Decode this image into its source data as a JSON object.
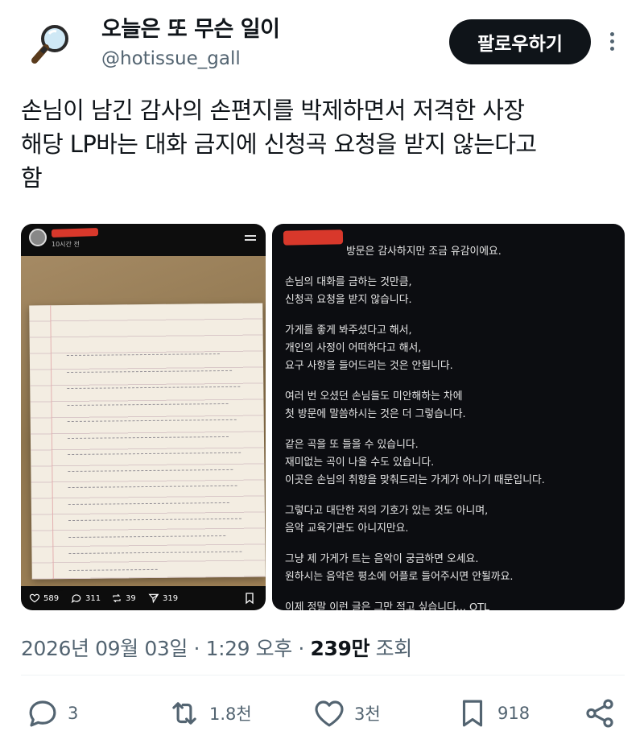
{
  "profile": {
    "display_name": "오늘은 또 무슨 일이",
    "handle": "@hotissue_gall",
    "avatar_icon": "magnifying-glass-icon"
  },
  "follow_button": "팔로우하기",
  "tweet": {
    "lines": [
      "손님이 남긴 감사의 손편지를 박제하면서 저격한 사장",
      "해당 LP바는 대화 금지에 신청곡 요청을 받지 않는다고",
      "함"
    ]
  },
  "left_image": {
    "time": "10시간 전",
    "likes": "589",
    "comments": "311",
    "reposts": "39",
    "shares": "319"
  },
  "right_image": {
    "paragraphs": [
      [
        "방문은 감사하지만 조금 유감이에요."
      ],
      [
        "손님의 대화를 금하는 것만큼,",
        "신청곡 요청을 받지 않습니다."
      ],
      [
        "가게를 좋게 봐주셨다고 해서,",
        "개인의 사정이 어떠하다고 해서,",
        "요구 사항을 들어드리는 것은 안됩니다."
      ],
      [
        "여러 번 오셨던 손님들도 미안해하는 차에",
        "첫 방문에 말씀하시는 것은 더 그렇습니다."
      ],
      [
        "같은 곡을 또 들을 수 있습니다.",
        "재미없는 곡이 나올 수도 있습니다.",
        "이곳은 손님의 취향을 맞춰드리는 가게가 아니기 때문입니다."
      ],
      [
        "그렇다고 대단한 저의 기호가 있는 것도 아니며,",
        "음악 교육기관도 아니지만요."
      ],
      [
        "그냥 제 가게가 트는 음악이 궁금하면 오세요.",
        "원하시는 음악은 평소에 어플로 들어주시면 안될까요."
      ],
      [
        "이제 정말 이런 글은 그만 적고 싶습니다... OTL"
      ]
    ]
  },
  "meta": {
    "date": "2026년 09월 03일",
    "sep1": " · ",
    "time": "1:29 오후",
    "sep2": " · ",
    "views_count": "239만",
    "views_label": " 조회"
  },
  "actions": {
    "replies": "3",
    "reposts": "1.8천",
    "likes": "3천",
    "bookmarks": "918"
  },
  "colors": {
    "follow_bg": "#0f1419",
    "secondary_text": "#536471",
    "redaction": "#d8382b"
  }
}
